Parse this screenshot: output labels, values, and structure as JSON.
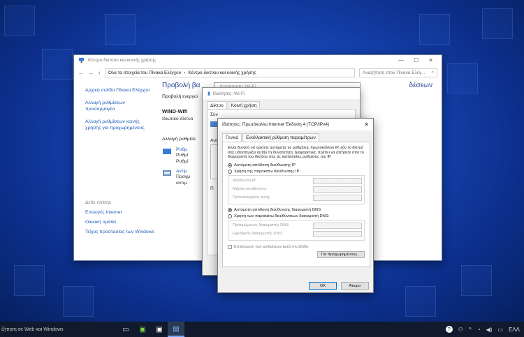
{
  "control_panel": {
    "title": "Κέντρο δικτύου και κοινής χρήσης",
    "breadcrumb": [
      "Όλα τα στοιχεία του Πίνακα Ελέγχου",
      "Κέντρο δικτύου και κοινής χρήσης"
    ],
    "search_placeholder": "Αναζήτηση στον Πίνακα Ελέγ...",
    "sidebar": {
      "links": [
        "Αρχική σελίδα Πίνακα Ελέγχου",
        "Αλλαγή ρυθμίσεων προσαρμογέα",
        "Αλλαγή ρυθμίσεων κοινής χρήσης για προχωρημένους"
      ],
      "see_also": "Δείτε επίσης",
      "see_also_links": [
        "Επιλογές Internet",
        "Οικιακή ομάδα",
        "Τείχος προστασίας των Windows"
      ]
    },
    "main": {
      "heading": "Προβολή βα",
      "heading_tail": "δέσεων",
      "active_networks": "Προβολή ενεργώ",
      "network_name": "WIND-Wifi",
      "network_type": "Ιδιωτικό δίκτυο",
      "change_settings": "Αλλαγή ρυθμίσε",
      "item1_link": "Ρυθμ",
      "item1_lines": [
        "Ρυθμί",
        "Ρυθμί"
      ],
      "item2_link": "Αντιμ",
      "item2_lines": [
        "Πραγμ",
        "αντιμ"
      ]
    }
  },
  "wifi_dialog": {
    "title": "Ιδιότητες: Wi-Fi",
    "behind_title": "Κατάσταση: Wi-Fi",
    "tabs": [
      "Δίκτυο",
      "Κοινή χρήση"
    ],
    "connect_label": "Σύν",
    "items_label": "Αυτ",
    "desc_label": "Π"
  },
  "ipv4_dialog": {
    "title": "Ιδιότητες: Πρωτόκολλο Internet Έκδοση 4 (TCP/IPv4)",
    "tabs": [
      "Γενικά",
      "Εναλλακτική ρύθμιση παραμέτρων"
    ],
    "description": "Είναι δυνατό να ορίσετε αυτόματα τις ρυθμίσεις πρωτοκόλλου IP, εάν το δίκτυό σας υποστηρίζει αυτήν τη δυνατότητα. Διαφορετικά, πρέπει να ζητήσετε από το διαχειριστή του δικτύου σας τις κατάλληλες ρυθμίσεις του IP.",
    "auto_ip": "Αυτόματη απόδοση διεύθυνσης IP",
    "manual_ip": "Χρήση της παρακάτω διεύθυνσης IP:",
    "ip_address": "Διεύθυνση IP:",
    "subnet_mask": "Μάσκα υποδικτύου:",
    "default_gateway": "Προεπιλεγμένη πύλη:",
    "auto_dns": "Αυτόματη απόδοση διεύθυνσης διακομιστή DNS",
    "manual_dns": "Χρήση των παρακάτω διευθύνσεων διακομιστή DNS:",
    "preferred_dns": "Προτιμώμενος διακομιστής DNS:",
    "alternate_dns": "Εφεδρικός διακομιστής DNS:",
    "validate": "Επικύρωση των ρυθμίσεων κατά την έξοδο",
    "advanced_button": "Για προχωρημένους...",
    "ok_button": "OK",
    "cancel_button": "Άκυρο"
  },
  "taskbar": {
    "search_text": "ζήτηση σε Web και Windows",
    "language": "ΕΛΛ"
  }
}
